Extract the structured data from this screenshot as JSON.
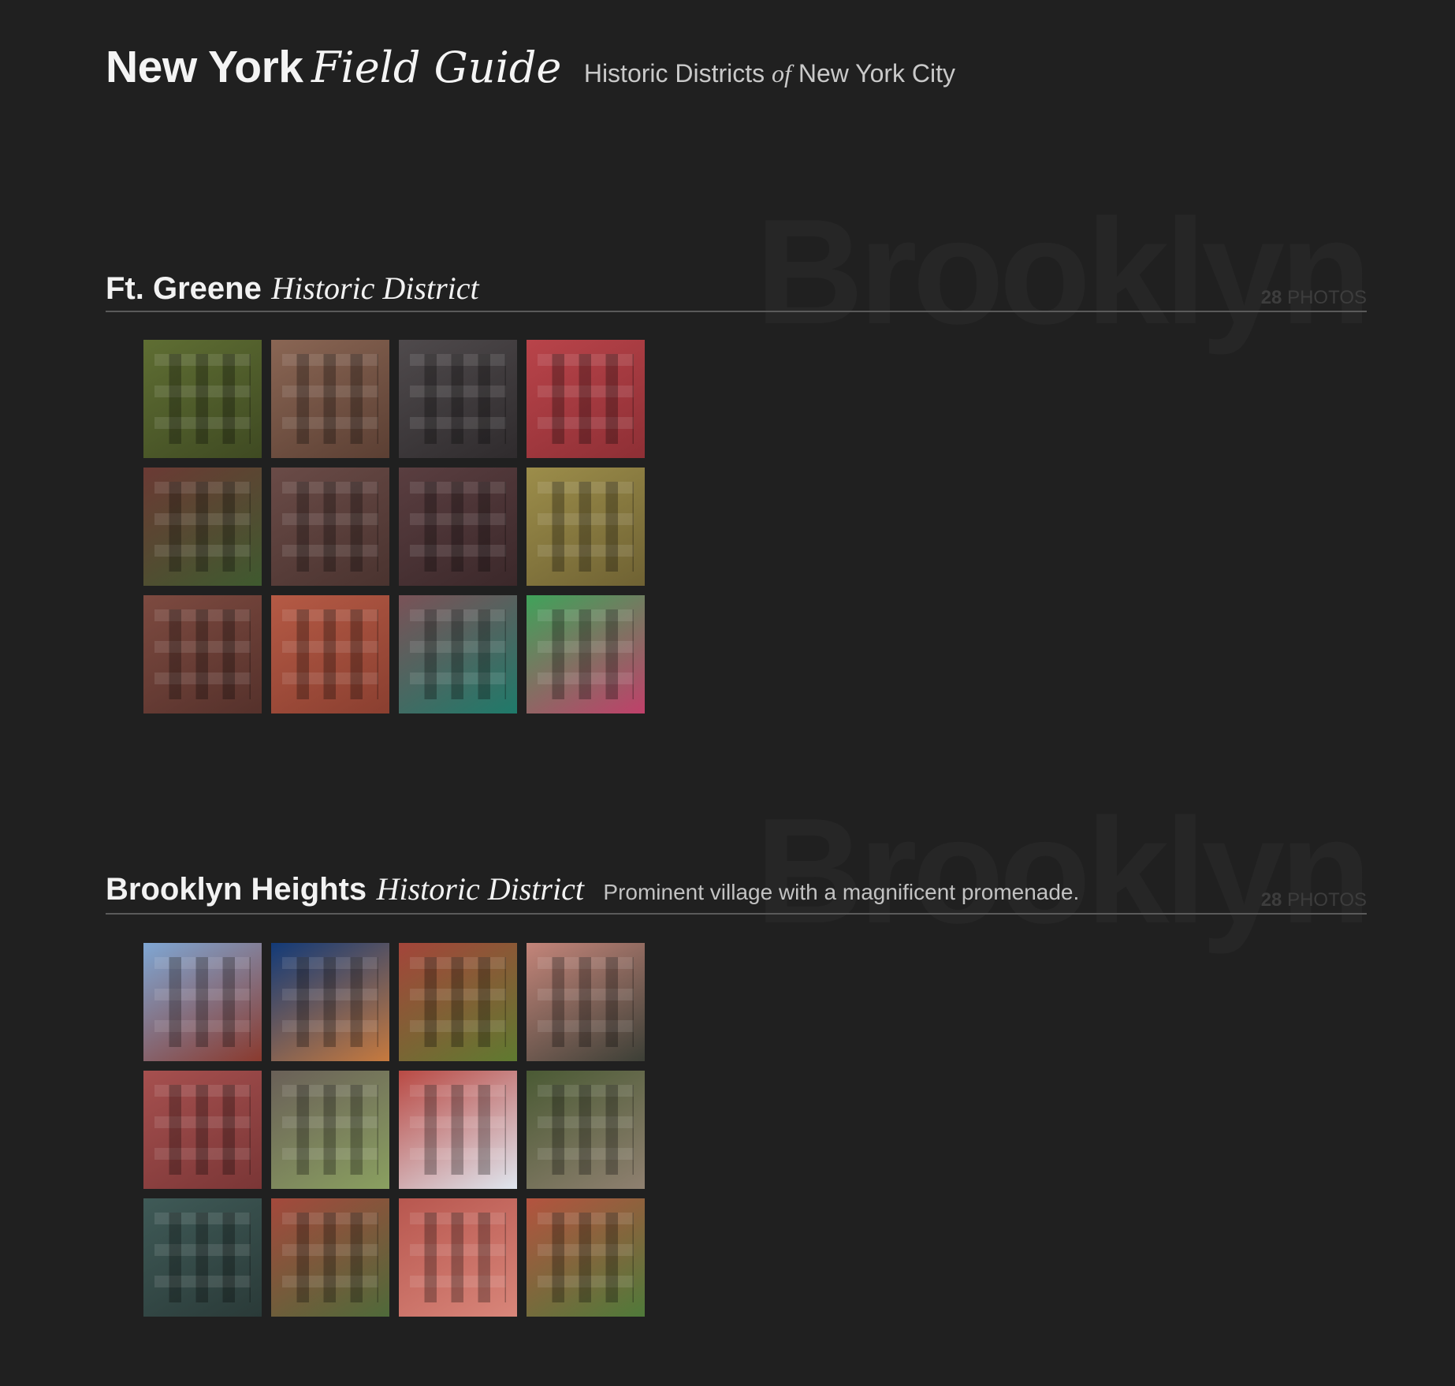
{
  "header": {
    "brand_bold": "New York",
    "brand_italic": "Field Guide",
    "tagline_pre": "Historic Districts",
    "tagline_of": "of",
    "tagline_post": "New York City"
  },
  "sections": [
    {
      "watermark": "Brooklyn",
      "name": "Ft. Greene",
      "type": "Historic District",
      "description": "",
      "count_number": "28",
      "count_label": "PHOTOS",
      "thumbs": [
        {
          "c1": "#5f6e33",
          "c2": "#3f4a22"
        },
        {
          "c1": "#8a6654",
          "c2": "#5b3f33"
        },
        {
          "c1": "#4f4a4c",
          "c2": "#2f2b2d"
        },
        {
          "c1": "#b9444a",
          "c2": "#8e2f35"
        },
        {
          "c1": "#6b3a34",
          "c2": "#3f5a2f"
        },
        {
          "c1": "#6a4b47",
          "c2": "#4a332f"
        },
        {
          "c1": "#5a3e40",
          "c2": "#3b282a"
        },
        {
          "c1": "#9c8d4a",
          "c2": "#6f6233"
        },
        {
          "c1": "#7d4a40",
          "c2": "#55312b"
        },
        {
          "c1": "#b55a45",
          "c2": "#8a3f30"
        },
        {
          "c1": "#7a5257",
          "c2": "#1f7a6a"
        },
        {
          "c1": "#3fa35a",
          "c2": "#c0406a"
        }
      ]
    },
    {
      "watermark": "Brooklyn",
      "name": "Brooklyn Heights",
      "type": "Historic District",
      "description": "Prominent village with a magnificent promenade.",
      "count_number": "28",
      "count_label": "PHOTOS",
      "thumbs": [
        {
          "c1": "#7fa7d4",
          "c2": "#8a3a2e"
        },
        {
          "c1": "#123a78",
          "c2": "#c77a3e"
        },
        {
          "c1": "#a4453a",
          "c2": "#5f7a30"
        },
        {
          "c1": "#c4857a",
          "c2": "#3c3f36"
        },
        {
          "c1": "#a6504f",
          "c2": "#7a3636"
        },
        {
          "c1": "#6a6058",
          "c2": "#8aa060"
        },
        {
          "c1": "#b94a44",
          "c2": "#dfe6ef"
        },
        {
          "c1": "#4a5a34",
          "c2": "#8f8070"
        },
        {
          "c1": "#3f5a57",
          "c2": "#2a3a38"
        },
        {
          "c1": "#a4493c",
          "c2": "#4f6a3a"
        },
        {
          "c1": "#b8574f",
          "c2": "#d8867a"
        },
        {
          "c1": "#b4533f",
          "c2": "#4f7a3a"
        }
      ]
    }
  ]
}
